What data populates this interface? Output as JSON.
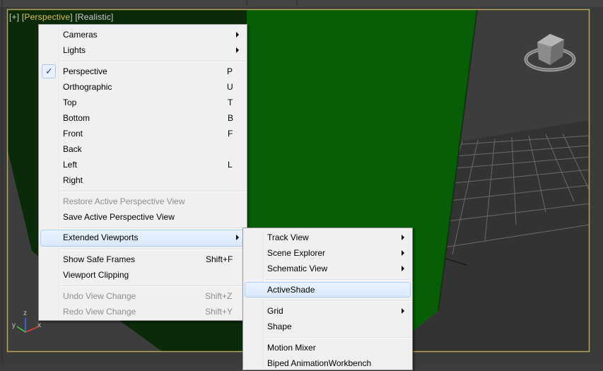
{
  "viewport": {
    "label_plus": "[+]",
    "label_view": "Perspective",
    "label_shading": "Realistic",
    "colors": {
      "frame": "#b8a55b",
      "green_box": "#075e07",
      "dark_bg": "#0e2a0e"
    }
  },
  "main_menu": {
    "items": [
      {
        "label": "Cameras",
        "shortcut": "",
        "submenu": true
      },
      {
        "label": "Lights",
        "shortcut": "",
        "submenu": true
      },
      {
        "label": "Perspective",
        "shortcut": "P",
        "checked": true
      },
      {
        "label": "Orthographic",
        "shortcut": "U"
      },
      {
        "label": "Top",
        "shortcut": "T"
      },
      {
        "label": "Bottom",
        "shortcut": "B"
      },
      {
        "label": "Front",
        "shortcut": "F"
      },
      {
        "label": "Back",
        "shortcut": ""
      },
      {
        "label": "Left",
        "shortcut": "L"
      },
      {
        "label": "Right",
        "shortcut": ""
      },
      {
        "label": "Restore Active Perspective View",
        "shortcut": "",
        "disabled": true
      },
      {
        "label": "Save Active Perspective View",
        "shortcut": ""
      },
      {
        "label": "Extended Viewports",
        "shortcut": "",
        "submenu": true,
        "highlighted": true
      },
      {
        "label": "Show Safe Frames",
        "shortcut": "Shift+F"
      },
      {
        "label": "Viewport Clipping",
        "shortcut": ""
      },
      {
        "label": "Undo View Change",
        "shortcut": "Shift+Z",
        "disabled": true
      },
      {
        "label": "Redo View Change",
        "shortcut": "Shift+Y",
        "disabled": true
      }
    ]
  },
  "sub_menu": {
    "items": [
      {
        "label": "Track View",
        "submenu": true
      },
      {
        "label": "Scene Explorer",
        "submenu": true
      },
      {
        "label": "Schematic View",
        "submenu": true
      },
      {
        "label": "ActiveShade",
        "highlighted": true
      },
      {
        "label": "Grid",
        "submenu": true
      },
      {
        "label": "Shape"
      },
      {
        "label": "Motion Mixer"
      },
      {
        "label": "Biped AnimationWorkbench"
      }
    ]
  },
  "gizmo": {
    "axis_x": "x",
    "axis_y": "y",
    "axis_z": "z"
  },
  "icons": {
    "checkmark": "✓",
    "viewcube": "viewcube-icon"
  }
}
